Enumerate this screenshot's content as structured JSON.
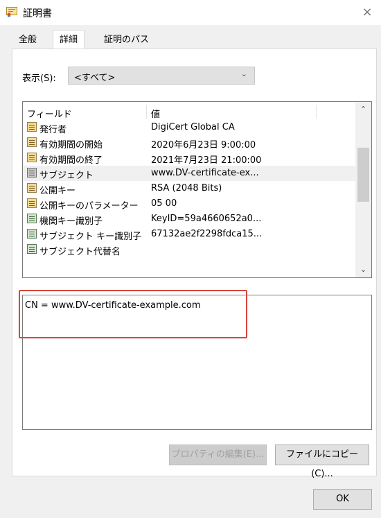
{
  "window": {
    "title": "証明書",
    "close_glyph": "×"
  },
  "tabs": [
    {
      "label": "全般"
    },
    {
      "label": "詳細"
    },
    {
      "label": "証明のパス"
    }
  ],
  "show": {
    "label": "表示(S):",
    "value": "<すべて>"
  },
  "fields": {
    "headers": {
      "field": "フィールド",
      "value": "値"
    },
    "rows": [
      {
        "name": "発行者",
        "value": "DigiCert Global CA",
        "icon": "certificate-field-icon"
      },
      {
        "name": "有効期間の開始",
        "value": "2020年6月23日 9:00:00",
        "icon": "certificate-field-icon"
      },
      {
        "name": "有効期間の終了",
        "value": "2021年7月23日 21:00:00",
        "icon": "certificate-field-icon"
      },
      {
        "name": "サブジェクト",
        "value": "www.DV-certificate-ex...",
        "icon": "certificate-field-icon"
      },
      {
        "name": "公開キー",
        "value": "RSA (2048 Bits)",
        "icon": "certificate-field-icon"
      },
      {
        "name": "公開キーのパラメーター",
        "value": "05 00",
        "icon": "certificate-field-icon"
      },
      {
        "name": "機関キー識別子",
        "value": "KeyID=59a4660652a0...",
        "icon": "extension-icon"
      },
      {
        "name": "サブジェクト キー識別子",
        "value": "67132ae2f2298fdca15...",
        "icon": "extension-icon"
      },
      {
        "name": "サブジェクト代替名",
        "value": "",
        "icon": "extension-icon"
      }
    ]
  },
  "detail": {
    "text": "CN = www.DV-certificate-example.com"
  },
  "buttons": {
    "edit_properties": "プロパティの編集(E)...",
    "copy_to_file": "ファイルにコピー(C)...",
    "ok": "OK"
  },
  "colors": {
    "highlight_border": "#d8473a",
    "selected_row": "#f0f0f0"
  }
}
